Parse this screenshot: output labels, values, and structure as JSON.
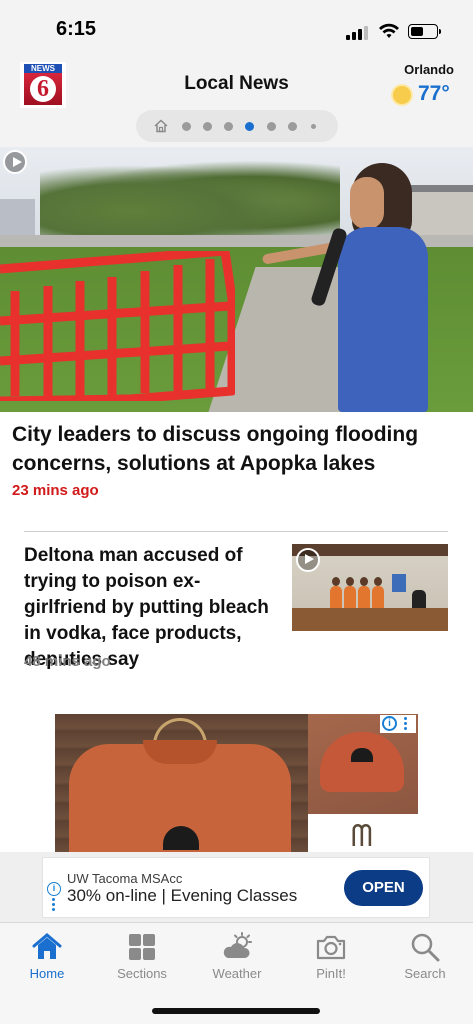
{
  "status_bar": {
    "time": "6:15"
  },
  "header": {
    "logo_text": "NEWS",
    "logo_number": "6",
    "title": "Local News",
    "weather": {
      "city": "Orlando",
      "temperature": "77°",
      "icon": "sun-icon"
    }
  },
  "page_indicator": {
    "count": 8,
    "active_index": 4
  },
  "hero_story": {
    "headline": "City leaders to discuss ongoing flooding concerns, solutions at Apopka lakes",
    "timestamp": "23 mins ago"
  },
  "stories": [
    {
      "headline": "Deltona man accused of trying to poison ex-girlfriend by putting bleach in vodka, face products, deputies say",
      "timestamp": "48 mins ago"
    }
  ],
  "banner_ad": {
    "advertiser": "UW Tacoma MSAcc",
    "text": "30% on-line | Evening Classes",
    "cta": "OPEN"
  },
  "tab_bar": {
    "items": [
      {
        "label": "Home",
        "icon": "home-icon",
        "active": true
      },
      {
        "label": "Sections",
        "icon": "grid-icon",
        "active": false
      },
      {
        "label": "Weather",
        "icon": "cloud-sun-icon",
        "active": false
      },
      {
        "label": "PinIt!",
        "icon": "camera-icon",
        "active": false
      },
      {
        "label": "Search",
        "icon": "search-icon",
        "active": false
      }
    ]
  },
  "colors": {
    "accent": "#1a6fcf",
    "timestamp_red": "#d11a1a",
    "cta_navy": "#0c3c86"
  }
}
